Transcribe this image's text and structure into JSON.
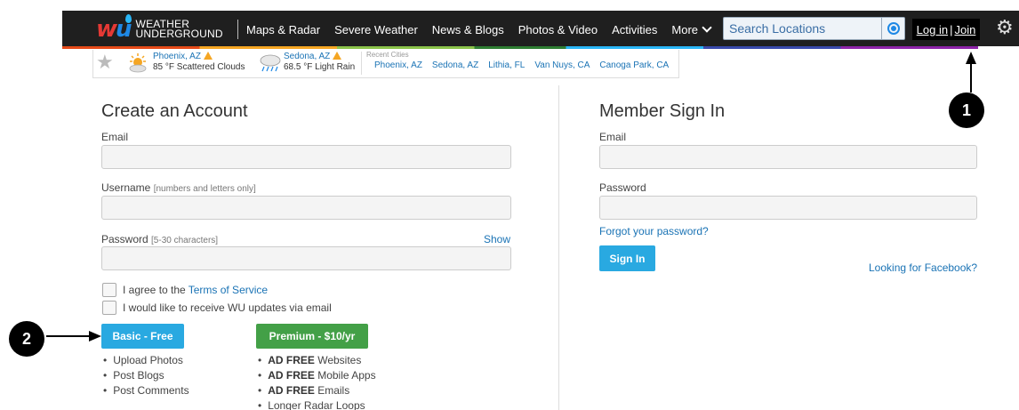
{
  "header": {
    "logo_mark_w": "w",
    "logo_mark_u": "u",
    "logo_line1": "WEATHER",
    "logo_line2": "UNDERGROUND",
    "nav": [
      "Maps & Radar",
      "Severe Weather",
      "News & Blogs",
      "Photos & Video",
      "Activities"
    ],
    "more_label": "More",
    "search_placeholder": "Search Locations",
    "login_label": "Log in",
    "login_sep": "|",
    "join_label": "Join"
  },
  "favorites": {
    "cities": [
      {
        "name": "Phoenix, AZ",
        "condition": "85 °F Scattered Clouds",
        "icon": "sun-cloud-icon"
      },
      {
        "name": "Sedona, AZ",
        "condition": "68.5 °F Light Rain",
        "icon": "rain-cloud-icon"
      }
    ],
    "recent_label": "Recent Cities",
    "recent": [
      "Phoenix, AZ",
      "Sedona, AZ",
      "Lithia, FL",
      "Van Nuys, CA",
      "Canoga Park, CA"
    ]
  },
  "create": {
    "title": "Create an Account",
    "email_label": "Email",
    "username_label": "Username",
    "username_hint": "[numbers and letters only]",
    "password_label": "Password",
    "password_hint": "[5-30 characters]",
    "show_label": "Show",
    "agree_text": "I agree to the",
    "terms_link": "Terms of Service",
    "updates_text": "I would like to receive WU updates via email",
    "basic_button": "Basic - Free",
    "premium_button": "Premium - $10/yr",
    "basic_features": [
      "Upload Photos",
      "Post Blogs",
      "Post Comments"
    ],
    "premium_features": [
      {
        "bold": "AD FREE",
        "rest": " Websites"
      },
      {
        "bold": "AD FREE",
        "rest": " Mobile Apps"
      },
      {
        "bold": "AD FREE",
        "rest": " Emails"
      },
      {
        "bold": "",
        "rest": "Longer Radar Loops"
      }
    ]
  },
  "signin": {
    "title": "Member Sign In",
    "email_label": "Email",
    "password_label": "Password",
    "forgot_link": "Forgot your password?",
    "signin_button": "Sign In",
    "facebook_link": "Looking for Facebook?"
  },
  "annotations": {
    "callout_1": "1",
    "callout_2": "2"
  },
  "colors": {
    "nav_bg": "#1f1f1f",
    "link": "#1a73b5",
    "basic_btn": "#29a9e1",
    "premium_btn": "#43a047"
  }
}
